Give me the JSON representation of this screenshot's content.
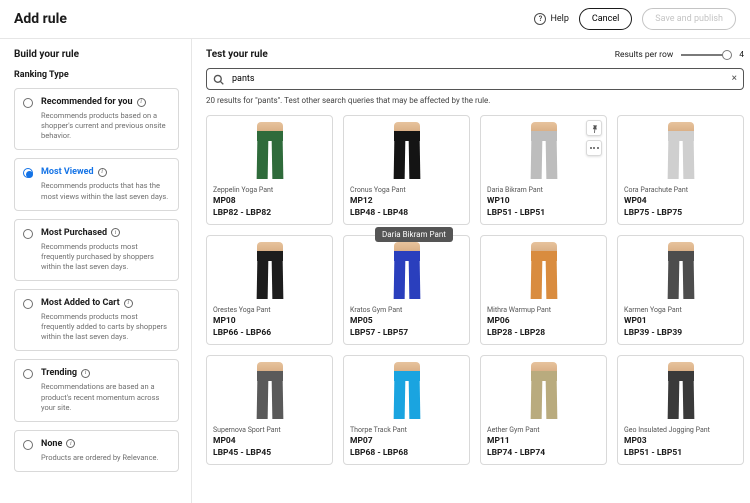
{
  "header": {
    "title": "Add rule",
    "help_label": "Help",
    "cancel_label": "Cancel",
    "save_label": "Save and publish"
  },
  "sidebar": {
    "build_title": "Build your rule",
    "ranking_title": "Ranking Type",
    "options": [
      {
        "key": "recommended",
        "title": "Recommended for you",
        "desc": "Recommends products based on a shopper's current and previous onsite behavior.",
        "selected": false
      },
      {
        "key": "most_viewed",
        "title": "Most Viewed",
        "desc": "Recommends products that has the most views within the last seven days.",
        "selected": true
      },
      {
        "key": "most_purchased",
        "title": "Most Purchased",
        "desc": "Recommends products most frequently purchased by shoppers within the last seven days.",
        "selected": false
      },
      {
        "key": "most_added",
        "title": "Most Added to Cart",
        "desc": "Recommends products most frequently added to carts by shoppers within the last seven days.",
        "selected": false
      },
      {
        "key": "trending",
        "title": "Trending",
        "desc": "Recommendations are based an a product's recent momentum across your site.",
        "selected": false
      },
      {
        "key": "none",
        "title": "None",
        "desc": "Products are ordered by Relevance.",
        "selected": false
      }
    ]
  },
  "main": {
    "test_title": "Test your rule",
    "results_per_row_label": "Results per row",
    "results_per_row_value": "4",
    "search_value": "pants",
    "results_hint": "20 results for \"pants\". Test other search queries that may be affected by the rule.",
    "tooltip_text": "Daria Bikram Pant",
    "products": [
      {
        "name": "Zeppelin Yoga Pant",
        "sku": "MP08",
        "range": "LBP82 - LBP82",
        "color": "#2f6b3b",
        "hovered": false
      },
      {
        "name": "Cronus Yoga Pant",
        "sku": "MP12",
        "range": "LBP48 - LBP48",
        "color": "#141414",
        "hovered": false
      },
      {
        "name": "Daria Bikram Pant",
        "sku": "WP10",
        "range": "LBP51 - LBP51",
        "color": "#bdbdbd",
        "hovered": true
      },
      {
        "name": "Cora Parachute Pant",
        "sku": "WP04",
        "range": "LBP75 - LBP75",
        "color": "#cfcfcf",
        "hovered": false
      },
      {
        "name": "Orestes Yoga Pant",
        "sku": "MP10",
        "range": "LBP66 - LBP66",
        "color": "#1d1d1d",
        "hovered": false
      },
      {
        "name": "Kratos Gym Pant",
        "sku": "MP05",
        "range": "LBP57 - LBP57",
        "color": "#2a3fbd",
        "hovered": false
      },
      {
        "name": "Mithra Warmup Pant",
        "sku": "MP06",
        "range": "LBP28 - LBP28",
        "color": "#d98c3f",
        "hovered": false
      },
      {
        "name": "Karmen Yoga Pant",
        "sku": "WP01",
        "range": "LBP39 - LBP39",
        "color": "#4d4d4d",
        "hovered": false
      },
      {
        "name": "Supernova Sport Pant",
        "sku": "MP04",
        "range": "LBP45 - LBP45",
        "color": "#5a5a5a",
        "hovered": false
      },
      {
        "name": "Thorpe Track Pant",
        "sku": "MP07",
        "range": "LBP68 - LBP68",
        "color": "#1aa4e0",
        "hovered": false
      },
      {
        "name": "Aether Gym Pant",
        "sku": "MP11",
        "range": "LBP74 - LBP74",
        "color": "#b9ab7e",
        "hovered": false
      },
      {
        "name": "Geo Insulated Jogging Pant",
        "sku": "MP03",
        "range": "LBP51 - LBP51",
        "color": "#3a3a3a",
        "hovered": false
      }
    ]
  }
}
